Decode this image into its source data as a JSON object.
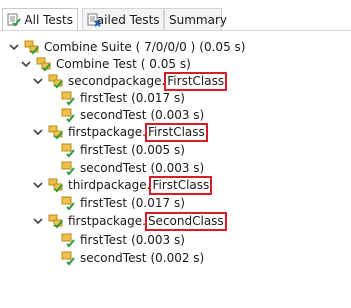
{
  "tabs": [
    {
      "label": "All Tests",
      "icon": "all-tests-icon"
    },
    {
      "label": "Failed Tests",
      "icon": "failed-tests-icon"
    },
    {
      "label": "Summary"
    }
  ],
  "tree": {
    "suite": {
      "label": "Combine Suite ( 7/0/0/0 )",
      "time": "(0.05 s)"
    },
    "test": {
      "label": "Combine Test",
      "time": "( 0.05 s)"
    },
    "classes": [
      {
        "package": "secondpackage.",
        "class": "FirstClass",
        "methods": [
          {
            "name": "firstTest",
            "time": "(0.017 s)"
          },
          {
            "name": "secondTest",
            "time": "(0.003 s)"
          }
        ]
      },
      {
        "package": "firstpackage.",
        "class": "FirstClass",
        "methods": [
          {
            "name": "firstTest",
            "time": "(0.005 s)"
          },
          {
            "name": "secondTest",
            "time": "(0.003 s)"
          }
        ]
      },
      {
        "package": "thirdpackage.",
        "class": "FirstClass",
        "methods": [
          {
            "name": "firstTest",
            "time": "(0.017 s)"
          }
        ]
      },
      {
        "package": "firstpackage.",
        "class": "SecondClass",
        "methods": [
          {
            "name": "firstTest",
            "time": "(0.003 s)"
          },
          {
            "name": "secondTest",
            "time": "(0.002 s)"
          }
        ]
      }
    ]
  },
  "colors": {
    "pass_green": "#2f9a3a",
    "highlight_red": "#d0202a",
    "node_gold": "#d8a02a"
  }
}
